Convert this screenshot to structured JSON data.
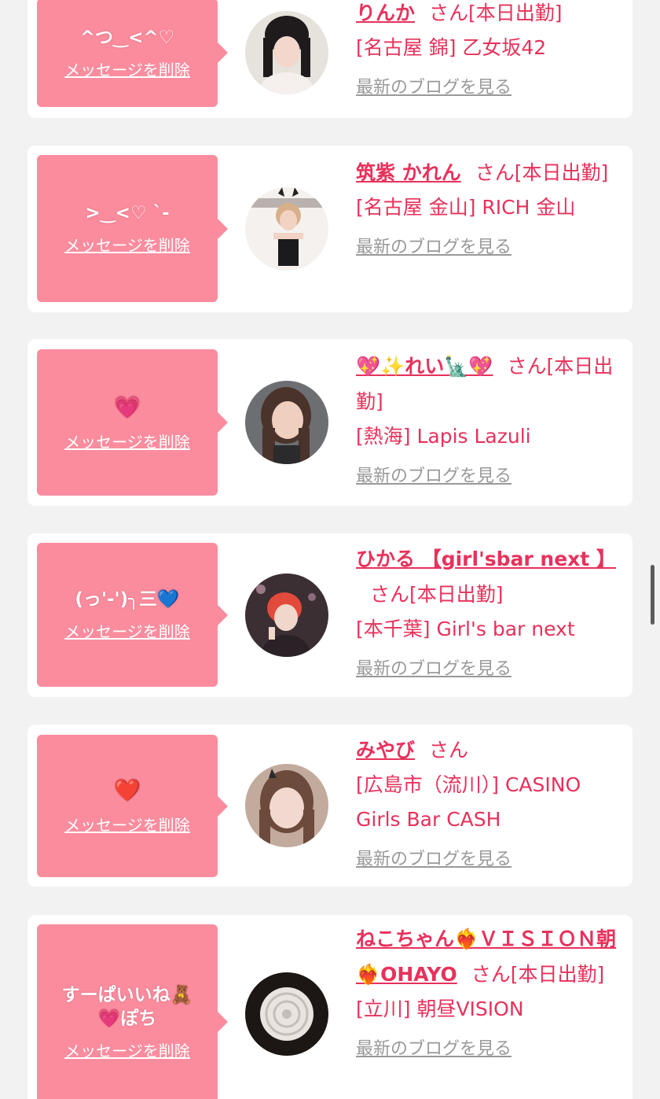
{
  "delete_label": "メッセージを削除",
  "blog_label": "最新のブログを見る",
  "san_label": "さん",
  "accent_color": "#fb8c9e",
  "name_color": "#e8315b",
  "cards": [
    {
      "message": "^つ‿<^♡",
      "name": "りんか",
      "status": "[本日出勤]",
      "shop": "[名古屋 錦] 乙女坂42"
    },
    {
      "message": ">‿<♡ ˋ-",
      "name": "筑紫 かれん",
      "status": "[本日出勤]",
      "shop": "[名古屋 金山] RICH 金山"
    },
    {
      "message": "💗",
      "name": "💖✨れい🗽💖",
      "status": "[本日出勤]",
      "shop": "[熱海] Lapis Lazuli"
    },
    {
      "message": "(っ'-')╮三💙",
      "name": "ひかる 【girl'sbar next 】",
      "status": "[本日出勤]",
      "shop": "[本千葉] Girl's bar next"
    },
    {
      "message": "❤️",
      "name": "みやび",
      "status": "",
      "shop": "[広島市（流川）] CASINO Girls Bar CASH"
    },
    {
      "message": "すーぱいいね🧸\n💗ぽち",
      "name": "ねこちゃん❤️‍🔥ＶＩＳＩＯＮ朝❤️‍🔥OHAYO",
      "status": "[本日出勤]",
      "shop": "[立川] 朝昼VISION"
    }
  ]
}
